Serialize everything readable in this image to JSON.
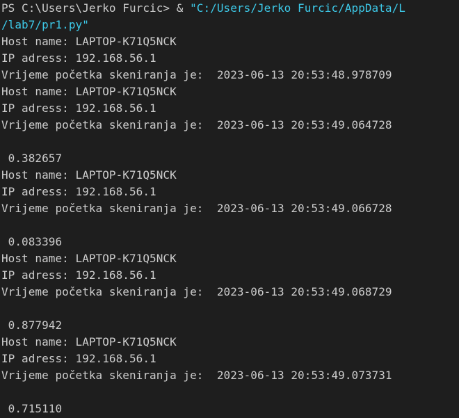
{
  "terminal": {
    "prompt": {
      "ps_text": "PS C:\\Users\\Jerko Furcic> & ",
      "string_part1": "\"C:/Users/Jerko Furcic/AppData/L",
      "string_part2": "/lab7/pr1.py\""
    },
    "blocks": [
      {
        "host": "Host name: LAPTOP-K71Q5NCK",
        "ip": "IP adress: 192.168.56.1",
        "time": "Vrijeme početka skeniranja je:  2023-06-13 20:53:48.978709"
      },
      {
        "host": "Host name: LAPTOP-K71Q5NCK",
        "ip": "IP adress: 192.168.56.1",
        "time": "Vrijeme početka skeniranja je:  2023-06-13 20:53:49.064728",
        "value": " 0.382657"
      },
      {
        "host": "Host name: LAPTOP-K71Q5NCK",
        "ip": "IP adress: 192.168.56.1",
        "time": "Vrijeme početka skeniranja je:  2023-06-13 20:53:49.066728",
        "value": " 0.083396"
      },
      {
        "host": "Host name: LAPTOP-K71Q5NCK",
        "ip": "IP adress: 192.168.56.1",
        "time": "Vrijeme početka skeniranja je:  2023-06-13 20:53:49.068729",
        "value": " 0.877942"
      },
      {
        "host": "Host name: LAPTOP-K71Q5NCK",
        "ip": "IP adress: 192.168.56.1",
        "time": "Vrijeme početka skeniranja je:  2023-06-13 20:53:49.073731",
        "value": " 0.715110"
      }
    ],
    "colors": {
      "background": "#1e1e1e",
      "text": "#cccccc",
      "string": "#3dc9e8"
    }
  }
}
